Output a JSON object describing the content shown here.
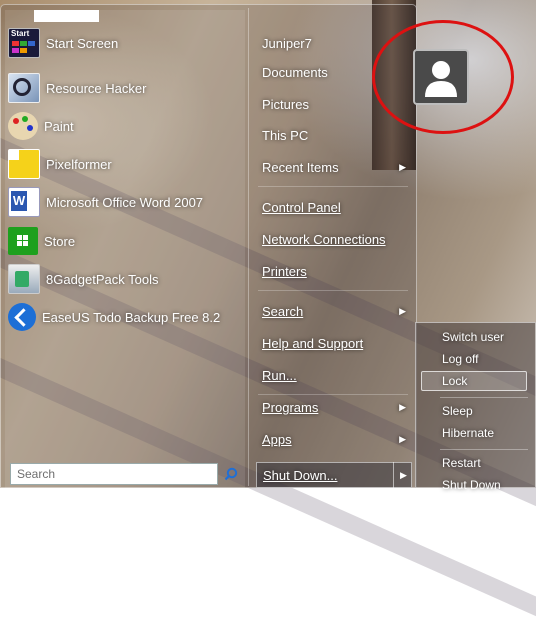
{
  "start_menu": {
    "left_pane": {
      "items": [
        {
          "label": "Start Screen",
          "icon": "start-screen-icon"
        },
        {
          "label": "Resource Hacker",
          "icon": "resource-hacker-icon"
        },
        {
          "label": "Paint",
          "icon": "paint-palette-icon"
        },
        {
          "label": "Pixelformer",
          "icon": "pixelformer-icon"
        },
        {
          "label": "Microsoft Office Word 2007",
          "icon": "word-icon"
        },
        {
          "label": "Store",
          "icon": "store-icon"
        },
        {
          "label": "8GadgetPack Tools",
          "icon": "gadgetpack-icon"
        },
        {
          "label": "EaseUS Todo Backup Free 8.2",
          "icon": "easeus-icon"
        }
      ],
      "search_placeholder": "Search",
      "start_icon_text": "Start"
    },
    "right_pane": {
      "items": [
        {
          "label": "Juniper7",
          "arrow": false
        },
        {
          "label": "Documents",
          "arrow": false
        },
        {
          "label": "Pictures",
          "arrow": false
        },
        {
          "label": "This PC",
          "arrow": false
        },
        {
          "label": "Recent Items",
          "arrow": true
        },
        {
          "label": "Control Panel",
          "arrow": false
        },
        {
          "label": "Network Connections",
          "arrow": false
        },
        {
          "label": "Printers",
          "arrow": false
        },
        {
          "label": "Search",
          "arrow": true
        },
        {
          "label": "Help and Support",
          "arrow": false
        },
        {
          "label": "Run...",
          "arrow": false
        },
        {
          "label": "Programs",
          "arrow": true
        },
        {
          "label": "Apps",
          "arrow": true
        }
      ],
      "shutdown_label": "Shut Down...",
      "arrow_glyph": "▶"
    },
    "shutdown_submenu": {
      "items": [
        "Switch user",
        "Log off",
        "Lock",
        "Sleep",
        "Hibernate",
        "Restart",
        "Shut Down"
      ],
      "highlighted": "Lock"
    },
    "colors": {
      "annotation_ring": "#dd1111",
      "avatar_bg": "#4a4a4a"
    }
  }
}
